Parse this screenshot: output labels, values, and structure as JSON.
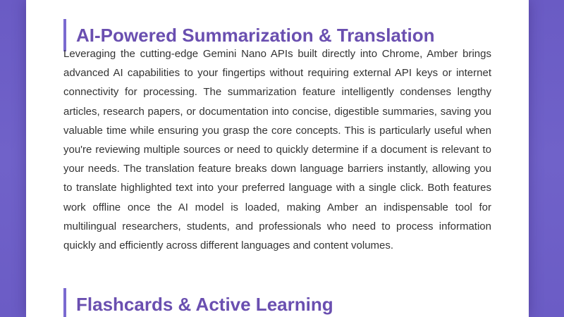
{
  "sections": [
    {
      "heading": "AI-Powered Summarization & Translation",
      "body": "Leveraging the cutting-edge Gemini Nano APIs built directly into Chrome, Amber brings advanced AI capabilities to your fingertips without requiring external API keys or internet connectivity for processing. The summarization feature intelligently condenses lengthy articles, research papers, or documentation into concise, digestible summaries, saving you valuable time while ensuring you grasp the core concepts. This is particularly useful when you're reviewing multiple sources or need to quickly determine if a document is relevant to your needs. The translation feature breaks down language barriers instantly, allowing you to translate highlighted text into your preferred language with a single click. Both features work offline once the AI model is loaded, making Amber an indispensable tool for multilingual researchers, students, and professionals who need to process information quickly and efficiently across different languages and content volumes."
    },
    {
      "heading": "Flashcards & Active Learning"
    }
  ],
  "colors": {
    "background": "#6b5cc5",
    "heading": "#6a4fb0",
    "accent_bar": "#7b6ad0",
    "body_text": "#333333",
    "card": "#ffffff"
  }
}
